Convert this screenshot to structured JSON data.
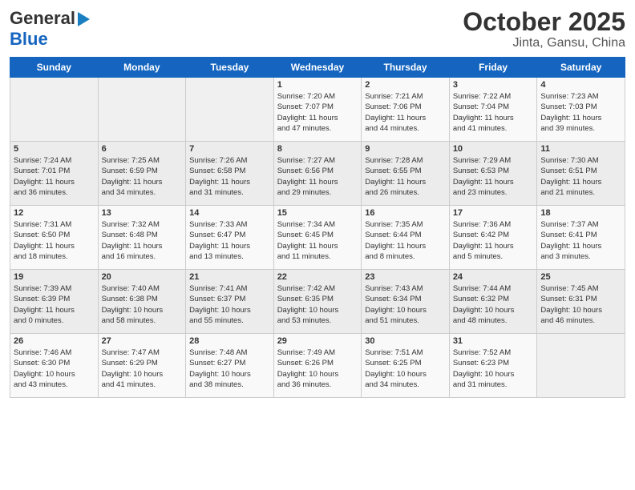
{
  "logo": {
    "line1": "General",
    "line2": "Blue",
    "arrow": "▶"
  },
  "title": "October 2025",
  "subtitle": "Jinta, Gansu, China",
  "days_of_week": [
    "Sunday",
    "Monday",
    "Tuesday",
    "Wednesday",
    "Thursday",
    "Friday",
    "Saturday"
  ],
  "weeks": [
    [
      {
        "day": "",
        "info": ""
      },
      {
        "day": "",
        "info": ""
      },
      {
        "day": "",
        "info": ""
      },
      {
        "day": "1",
        "info": "Sunrise: 7:20 AM\nSunset: 7:07 PM\nDaylight: 11 hours\nand 47 minutes."
      },
      {
        "day": "2",
        "info": "Sunrise: 7:21 AM\nSunset: 7:06 PM\nDaylight: 11 hours\nand 44 minutes."
      },
      {
        "day": "3",
        "info": "Sunrise: 7:22 AM\nSunset: 7:04 PM\nDaylight: 11 hours\nand 41 minutes."
      },
      {
        "day": "4",
        "info": "Sunrise: 7:23 AM\nSunset: 7:03 PM\nDaylight: 11 hours\nand 39 minutes."
      }
    ],
    [
      {
        "day": "5",
        "info": "Sunrise: 7:24 AM\nSunset: 7:01 PM\nDaylight: 11 hours\nand 36 minutes."
      },
      {
        "day": "6",
        "info": "Sunrise: 7:25 AM\nSunset: 6:59 PM\nDaylight: 11 hours\nand 34 minutes."
      },
      {
        "day": "7",
        "info": "Sunrise: 7:26 AM\nSunset: 6:58 PM\nDaylight: 11 hours\nand 31 minutes."
      },
      {
        "day": "8",
        "info": "Sunrise: 7:27 AM\nSunset: 6:56 PM\nDaylight: 11 hours\nand 29 minutes."
      },
      {
        "day": "9",
        "info": "Sunrise: 7:28 AM\nSunset: 6:55 PM\nDaylight: 11 hours\nand 26 minutes."
      },
      {
        "day": "10",
        "info": "Sunrise: 7:29 AM\nSunset: 6:53 PM\nDaylight: 11 hours\nand 23 minutes."
      },
      {
        "day": "11",
        "info": "Sunrise: 7:30 AM\nSunset: 6:51 PM\nDaylight: 11 hours\nand 21 minutes."
      }
    ],
    [
      {
        "day": "12",
        "info": "Sunrise: 7:31 AM\nSunset: 6:50 PM\nDaylight: 11 hours\nand 18 minutes."
      },
      {
        "day": "13",
        "info": "Sunrise: 7:32 AM\nSunset: 6:48 PM\nDaylight: 11 hours\nand 16 minutes."
      },
      {
        "day": "14",
        "info": "Sunrise: 7:33 AM\nSunset: 6:47 PM\nDaylight: 11 hours\nand 13 minutes."
      },
      {
        "day": "15",
        "info": "Sunrise: 7:34 AM\nSunset: 6:45 PM\nDaylight: 11 hours\nand 11 minutes."
      },
      {
        "day": "16",
        "info": "Sunrise: 7:35 AM\nSunset: 6:44 PM\nDaylight: 11 hours\nand 8 minutes."
      },
      {
        "day": "17",
        "info": "Sunrise: 7:36 AM\nSunset: 6:42 PM\nDaylight: 11 hours\nand 5 minutes."
      },
      {
        "day": "18",
        "info": "Sunrise: 7:37 AM\nSunset: 6:41 PM\nDaylight: 11 hours\nand 3 minutes."
      }
    ],
    [
      {
        "day": "19",
        "info": "Sunrise: 7:39 AM\nSunset: 6:39 PM\nDaylight: 11 hours\nand 0 minutes."
      },
      {
        "day": "20",
        "info": "Sunrise: 7:40 AM\nSunset: 6:38 PM\nDaylight: 10 hours\nand 58 minutes."
      },
      {
        "day": "21",
        "info": "Sunrise: 7:41 AM\nSunset: 6:37 PM\nDaylight: 10 hours\nand 55 minutes."
      },
      {
        "day": "22",
        "info": "Sunrise: 7:42 AM\nSunset: 6:35 PM\nDaylight: 10 hours\nand 53 minutes."
      },
      {
        "day": "23",
        "info": "Sunrise: 7:43 AM\nSunset: 6:34 PM\nDaylight: 10 hours\nand 51 minutes."
      },
      {
        "day": "24",
        "info": "Sunrise: 7:44 AM\nSunset: 6:32 PM\nDaylight: 10 hours\nand 48 minutes."
      },
      {
        "day": "25",
        "info": "Sunrise: 7:45 AM\nSunset: 6:31 PM\nDaylight: 10 hours\nand 46 minutes."
      }
    ],
    [
      {
        "day": "26",
        "info": "Sunrise: 7:46 AM\nSunset: 6:30 PM\nDaylight: 10 hours\nand 43 minutes."
      },
      {
        "day": "27",
        "info": "Sunrise: 7:47 AM\nSunset: 6:29 PM\nDaylight: 10 hours\nand 41 minutes."
      },
      {
        "day": "28",
        "info": "Sunrise: 7:48 AM\nSunset: 6:27 PM\nDaylight: 10 hours\nand 38 minutes."
      },
      {
        "day": "29",
        "info": "Sunrise: 7:49 AM\nSunset: 6:26 PM\nDaylight: 10 hours\nand 36 minutes."
      },
      {
        "day": "30",
        "info": "Sunrise: 7:51 AM\nSunset: 6:25 PM\nDaylight: 10 hours\nand 34 minutes."
      },
      {
        "day": "31",
        "info": "Sunrise: 7:52 AM\nSunset: 6:23 PM\nDaylight: 10 hours\nand 31 minutes."
      },
      {
        "day": "",
        "info": ""
      }
    ]
  ]
}
